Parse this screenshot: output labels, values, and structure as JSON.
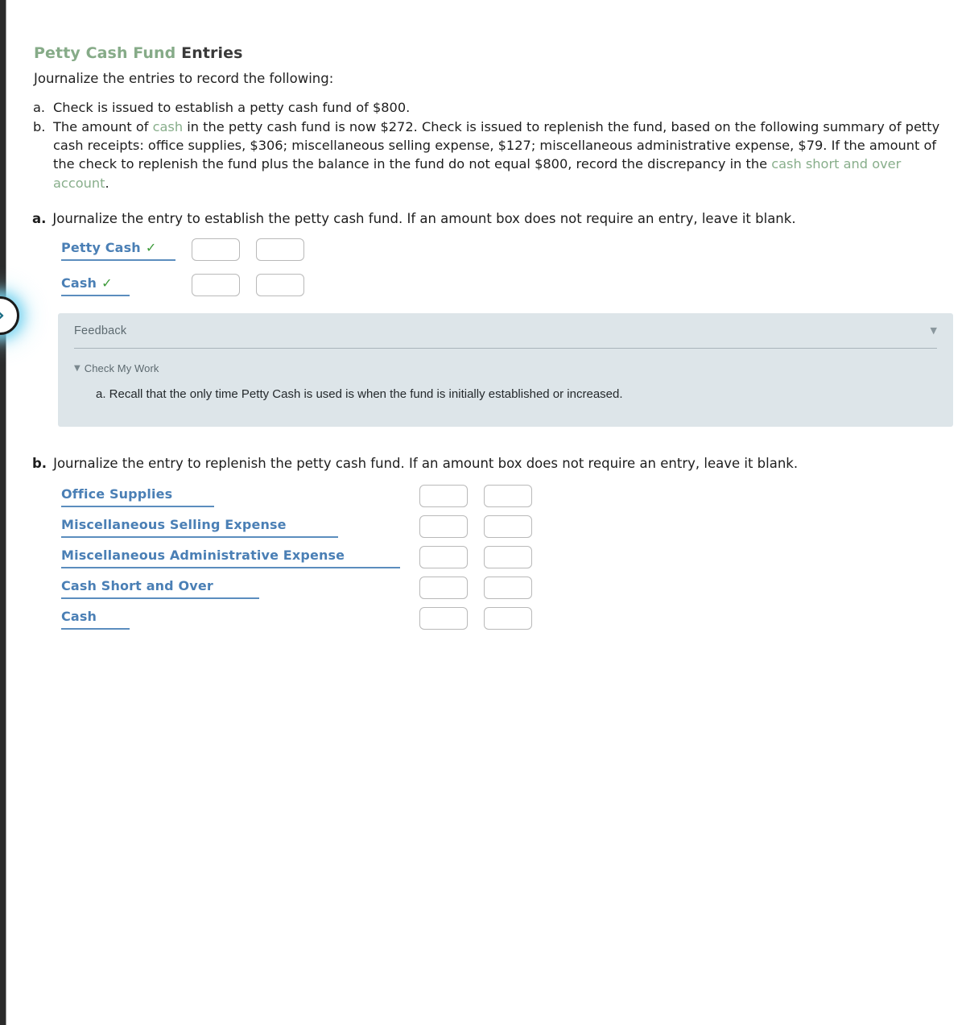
{
  "page": {
    "title_green": "Petty Cash Fund",
    "title_dark": "Entries",
    "intro": "Journalize the entries to record the following:"
  },
  "nav": {
    "next_button_icon": "chevron-right-icon"
  },
  "problems": [
    {
      "marker": "a.",
      "segments": [
        {
          "text": "Check is issued to establish a petty cash fund of $800.",
          "style": "plain"
        }
      ]
    },
    {
      "marker": "b.",
      "segments": [
        {
          "text": "The amount of ",
          "style": "plain"
        },
        {
          "text": "cash",
          "style": "green"
        },
        {
          "text": " in the petty cash fund is now $272. Check is issued to replenish the fund, based on the following summary of petty cash receipts: office supplies, $306; miscellaneous selling expense, $127; miscellaneous administrative expense, $79. If the amount of the check to replenish the fund plus the balance in the fund do not equal $800, record the discrepancy in the ",
          "style": "plain"
        },
        {
          "text": "cash short and over account",
          "style": "green"
        },
        {
          "text": ".",
          "style": "plain"
        }
      ]
    }
  ],
  "subquestion_a": {
    "letter": "a.",
    "prompt": "Journalize the entry to establish the petty cash fund. If an amount box does not require an entry, leave it blank.",
    "rows": [
      {
        "account": "Petty Cash",
        "checked": true,
        "check_glyph": "✓",
        "debit": "",
        "credit": "",
        "underline_width": 142
      },
      {
        "account": "Cash",
        "checked": true,
        "check_glyph": "✓",
        "debit": "",
        "credit": "",
        "underline_width": 85
      }
    ]
  },
  "subquestion_b": {
    "letter": "b.",
    "prompt": "Journalize the entry to replenish the petty cash fund. If an amount box does not require an entry, leave it blank.",
    "rows": [
      {
        "account": "Office Supplies",
        "checked": false,
        "check_glyph": "",
        "debit": "",
        "credit": "",
        "underline_width": 190
      },
      {
        "account": "Miscellaneous Selling Expense",
        "checked": false,
        "check_glyph": "",
        "debit": "",
        "credit": "",
        "underline_width": 344
      },
      {
        "account": "Miscellaneous Administrative Expense",
        "checked": false,
        "check_glyph": "",
        "debit": "",
        "credit": "",
        "underline_width": 421
      },
      {
        "account": "Cash Short and Over",
        "checked": false,
        "check_glyph": "",
        "debit": "",
        "credit": "",
        "underline_width": 246
      },
      {
        "account": "Cash",
        "checked": false,
        "check_glyph": "",
        "debit": "",
        "credit": "",
        "underline_width": 85
      }
    ]
  },
  "feedback": {
    "title": "Feedback",
    "collapse_glyph": "▼",
    "check_my_work_caret": "▼",
    "check_my_work_label": "Check My Work",
    "body": "a. Recall that the only time Petty Cash is used is when the fund is initially established or increased."
  },
  "colors": {
    "accent_blue": "#4a7fb5",
    "underline_blue": "#5b8dbe",
    "check_green": "#3c9a39",
    "term_green": "#88ae8b",
    "title_green": "#86ab88",
    "feedback_bg": "#dde5e9",
    "input_border": "#b9b9b9"
  }
}
